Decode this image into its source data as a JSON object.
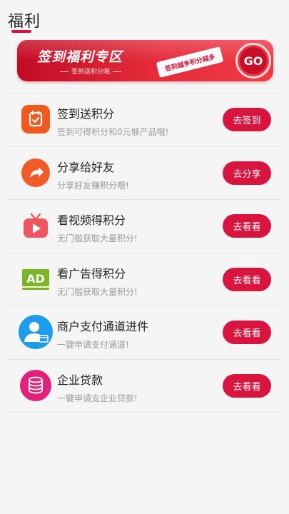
{
  "header": {
    "title": "福利"
  },
  "banner": {
    "title": "签到福利专区",
    "subtitle": "签到送积分哦",
    "ribbon": "签到越多积分越多",
    "go_label": "GO"
  },
  "items": [
    {
      "title": "签到送积分",
      "desc": "签到可得积分和0元够产品哦!",
      "button": "去签到",
      "icon": "calendar-check-icon",
      "icon_color": "#f1591f"
    },
    {
      "title": "分享给好友",
      "desc": "分享好友赚积分哦!",
      "button": "去分享",
      "icon": "share-arrow-icon",
      "icon_color": "#f25a26"
    },
    {
      "title": "看视频得积分",
      "desc": "无门槛获取大量积分!",
      "button": "去看看",
      "icon": "video-play-icon",
      "icon_color": "#f0565f"
    },
    {
      "title": "看广告得积分",
      "desc": "无门槛获取大量积分!",
      "button": "去看看",
      "icon": "ad-icon",
      "icon_color": "#7cb524"
    },
    {
      "title": "商户支付通道进件",
      "desc": "一键申请支付通道!",
      "button": "去看看",
      "icon": "merchant-user-icon",
      "icon_color": "#1c9cea"
    },
    {
      "title": "企业贷款",
      "desc": "一键申请支企业贷款!",
      "button": "去看看",
      "icon": "coins-icon",
      "icon_color": "#e0227d"
    }
  ]
}
